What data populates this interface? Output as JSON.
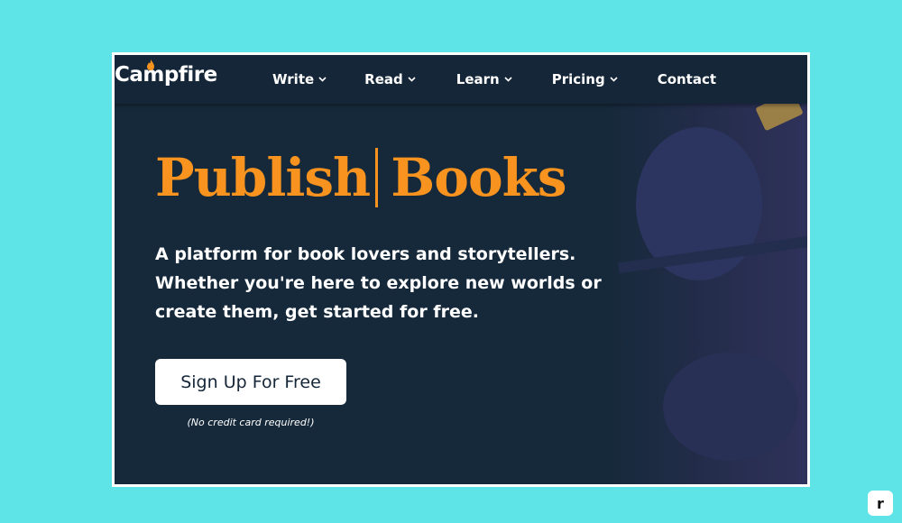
{
  "colors": {
    "page_background": "#5ee3e6",
    "site_background": "#16293a",
    "accent": "#f7931e",
    "button_background": "#ffffff"
  },
  "nav": {
    "logo": "Campfire",
    "items": [
      {
        "label": "Write",
        "icon": "chevron-down-icon"
      },
      {
        "label": "Read",
        "icon": "chevron-down-icon"
      },
      {
        "label": "Learn",
        "icon": "chevron-down-icon"
      },
      {
        "label": "Pricing",
        "icon": "chevron-down-icon"
      },
      {
        "label": "Contact"
      }
    ]
  },
  "hero": {
    "title_word1": "Publish",
    "title_word2": "Books",
    "description": "A platform for book lovers and storytellers. Whether you're here to explore new worlds or create them, get started for free.",
    "cta_label": "Sign Up For Free",
    "note": "(No credit card required!)"
  },
  "corner_badge": "r"
}
